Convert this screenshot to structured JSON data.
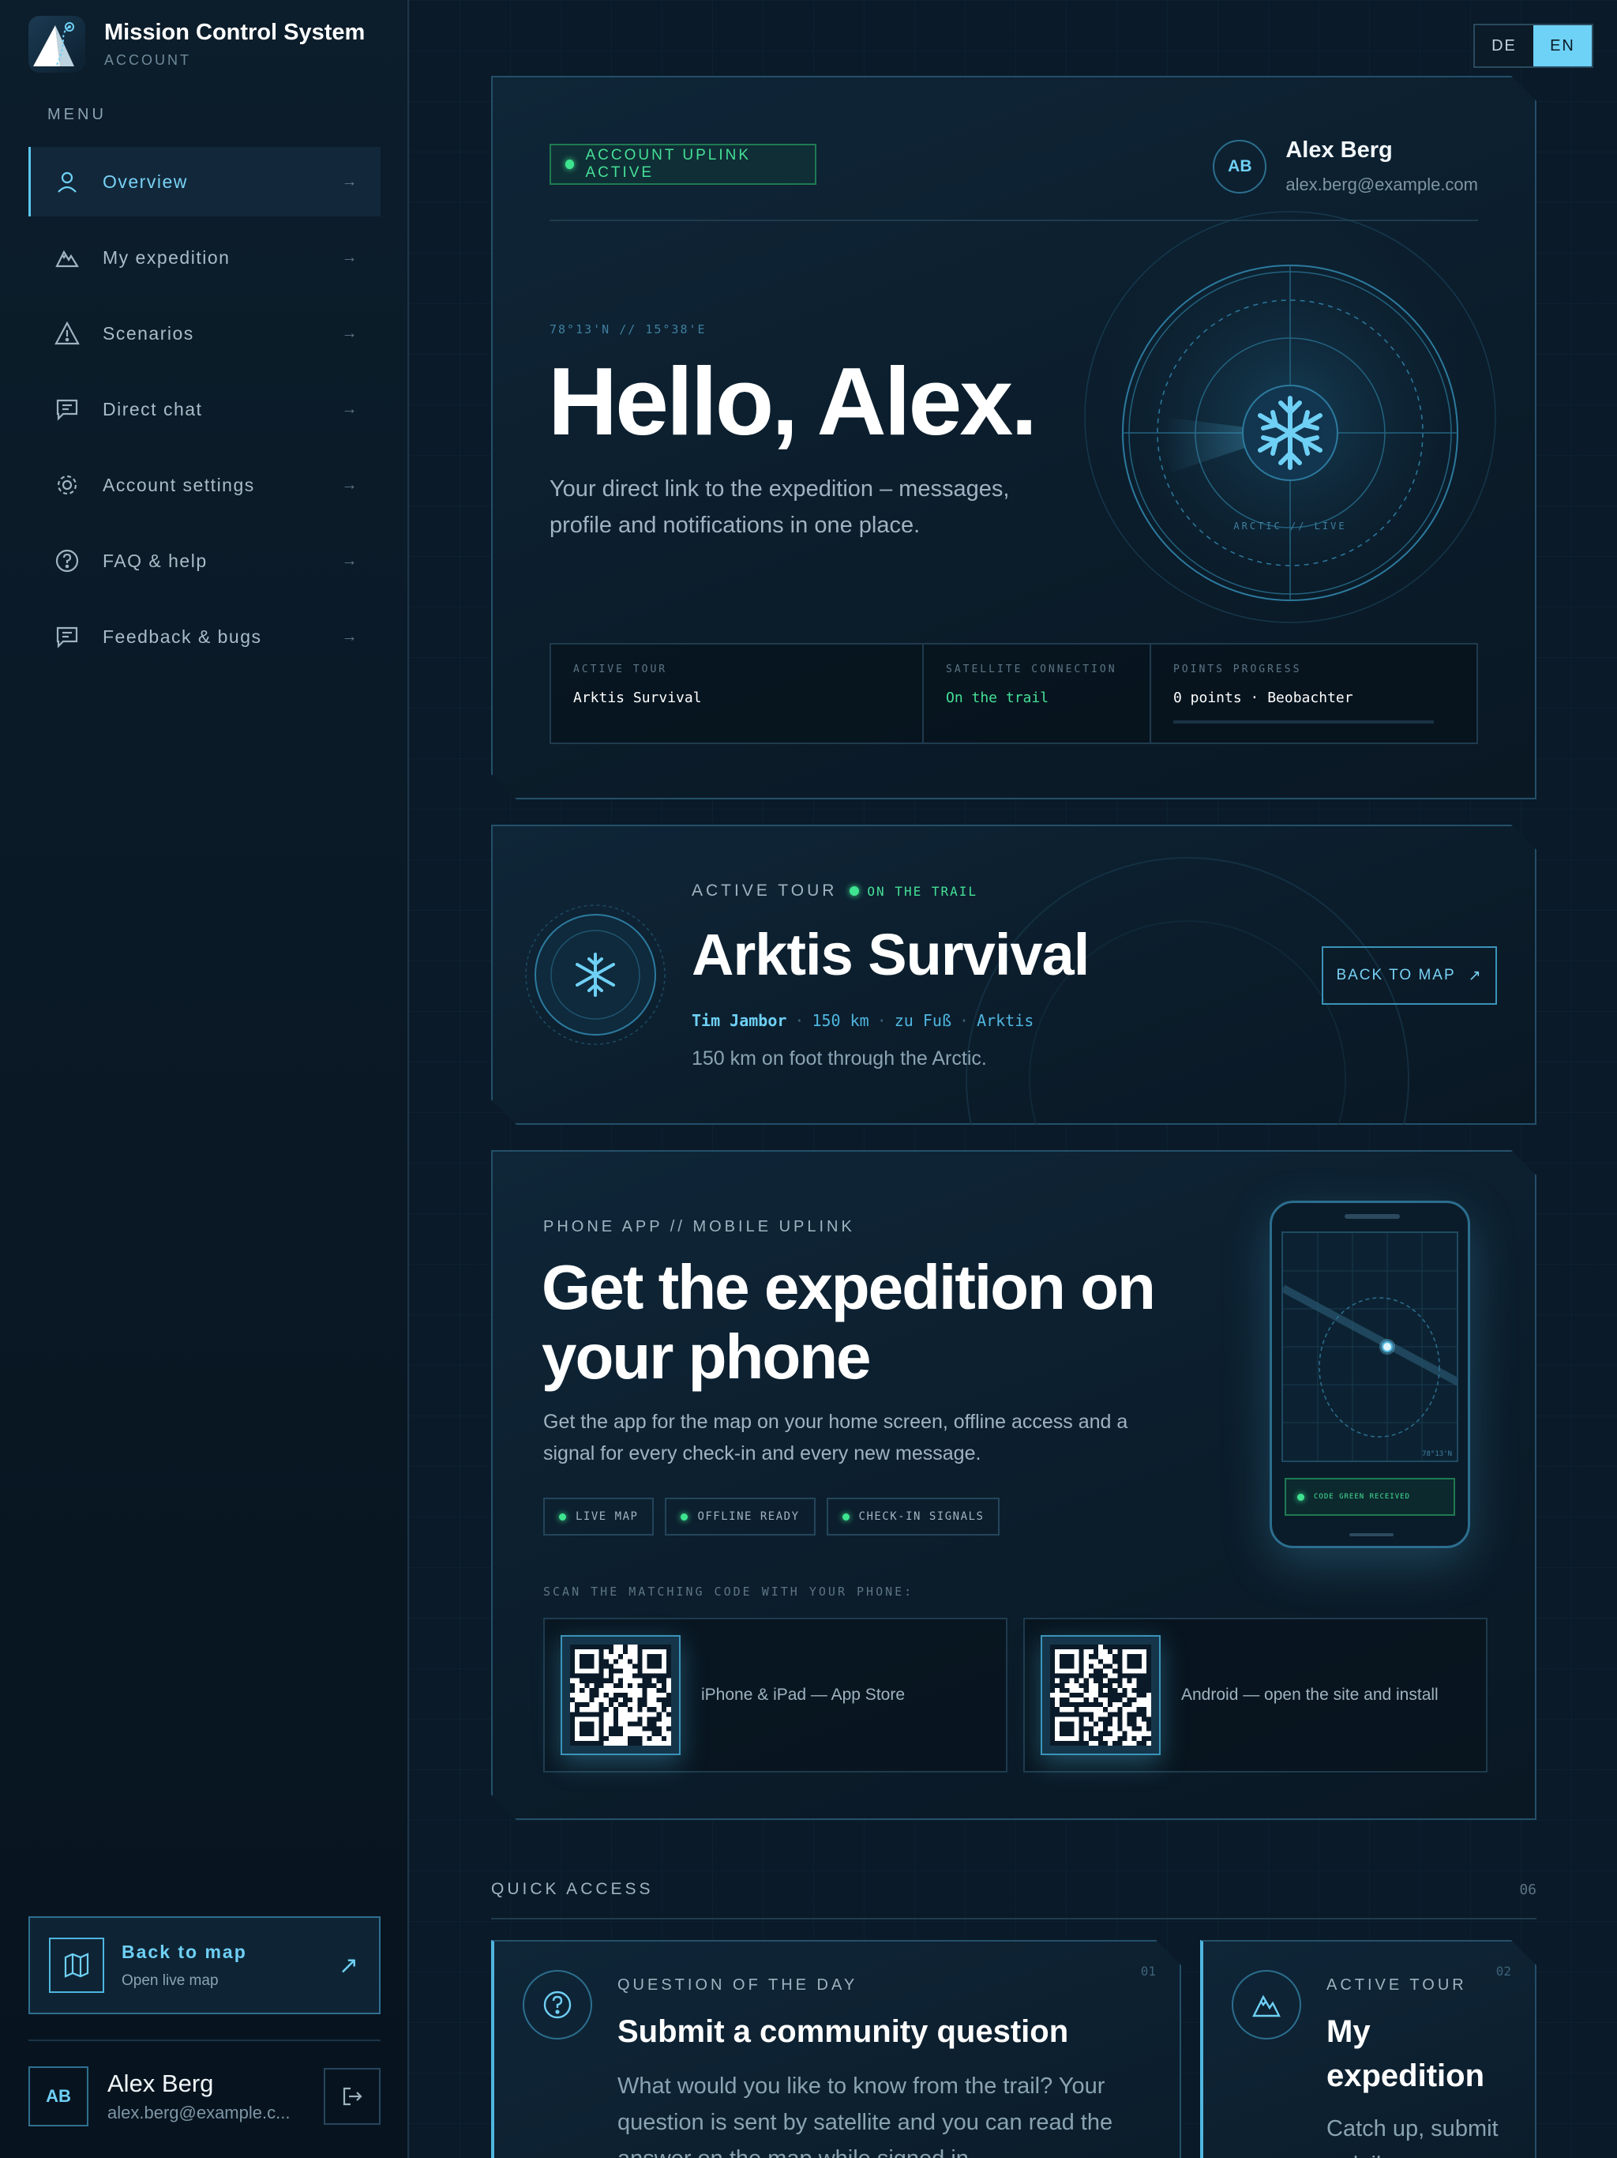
{
  "app": {
    "title": "Mission Control System",
    "subtitle": "ACCOUNT"
  },
  "sidebar": {
    "menu_label": "MENU",
    "items": [
      {
        "label": "Overview",
        "icon": "user-icon",
        "active": true
      },
      {
        "label": "My expedition",
        "icon": "mountain-icon",
        "active": false
      },
      {
        "label": "Scenarios",
        "icon": "warning-icon",
        "active": false
      },
      {
        "label": "Direct chat",
        "icon": "chat-icon",
        "active": false
      },
      {
        "label": "Account settings",
        "icon": "gear-icon",
        "active": false
      },
      {
        "label": "FAQ & help",
        "icon": "help-icon",
        "active": false
      },
      {
        "label": "Feedback & bugs",
        "icon": "feedback-icon",
        "active": false
      }
    ],
    "arrow": "→",
    "back_map": {
      "title": "Back to map",
      "subtitle": "Open live map",
      "arrow": "↗"
    },
    "user": {
      "initials": "AB",
      "name": "Alex Berg",
      "email": "alex.berg@example.c..."
    }
  },
  "lang": {
    "de": "DE",
    "en": "EN",
    "active": "EN"
  },
  "hero": {
    "uplink": "ACCOUNT UPLINK ACTIVE",
    "user": {
      "initials": "AB",
      "name": "Alex Berg",
      "email": "alex.berg@example.com"
    },
    "coords": "78°13'N // 15°38'E",
    "greeting": "Hello, Alex.",
    "description": "Your direct link to the expedition – messages, profile and notifications in one place.",
    "radar_label": "ARCTIC // LIVE",
    "stats": [
      {
        "label": "ACTIVE TOUR",
        "value": "Arktis Survival"
      },
      {
        "label": "SATELLITE CONNECTION",
        "value": "On the trail"
      },
      {
        "label": "POINTS PROGRESS",
        "value": "0 points · Beobachter",
        "progress": 0
      }
    ]
  },
  "tour": {
    "kicker": "ACTIVE TOUR",
    "status": "ON THE TRAIL",
    "title": "Arktis Survival",
    "meta": {
      "guide": "Tim Jambor",
      "distance": "150 km",
      "mode": "zu Fuß",
      "region": "Arktis",
      "sep": "·"
    },
    "description": "150 km on foot through the Arctic.",
    "button": "BACK TO MAP",
    "button_arrow": "↗"
  },
  "app_promo": {
    "kicker": "PHONE APP // MOBILE UPLINK",
    "title": "Get the expedition on your phone",
    "description": "Get the app for the map on your home screen, offline access and a signal for every check-in and every new message.",
    "chips": [
      "LIVE MAP",
      "OFFLINE READY",
      "CHECK-IN SIGNALS"
    ],
    "scan_label": "SCAN THE MATCHING CODE WITH YOUR PHONE:",
    "qr_cards": [
      {
        "label": "iPhone & iPad — App Store"
      },
      {
        "label": "Android — open the site and install"
      }
    ],
    "phone": {
      "coords": "78°13'N",
      "status": "CODE GREEN RECEIVED"
    }
  },
  "quick_access": {
    "title": "QUICK ACCESS",
    "count": "06",
    "cards": [
      {
        "number": "01",
        "kicker": "QUESTION OF THE DAY",
        "title": "Submit a community question",
        "description": "What would you like to know from the trail? Your question is sent by satellite and you can read the answer on the map while signed in."
      },
      {
        "number": "02",
        "kicker": "ACTIVE TOUR",
        "title": "My expedition",
        "description": "Catch up, submit a daily"
      }
    ]
  },
  "colors": {
    "accent": "#6fd0f5",
    "success": "#45e096",
    "background": "#071520",
    "panel": "#0f2638"
  }
}
